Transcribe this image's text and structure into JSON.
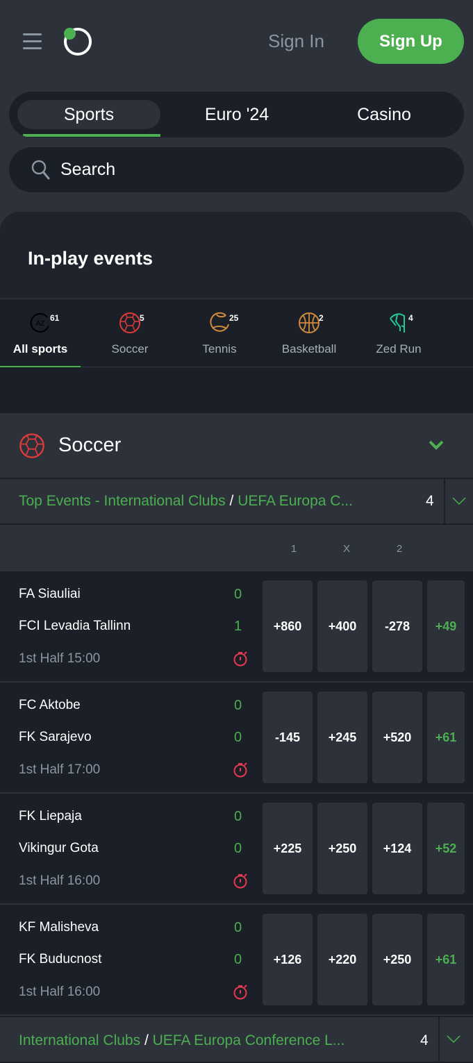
{
  "header": {
    "sign_in": "Sign In",
    "sign_up": "Sign Up"
  },
  "tabs": [
    {
      "label": "Sports",
      "active": true
    },
    {
      "label": "Euro '24"
    },
    {
      "label": "Casino"
    }
  ],
  "search": {
    "placeholder": "Search"
  },
  "inplay": {
    "title": "In-play events"
  },
  "sports": [
    {
      "label": "All sports",
      "count": "61",
      "icon": "az-icon",
      "color": "#000000"
    },
    {
      "label": "Soccer",
      "count": "5",
      "icon": "soccer-ball-icon",
      "color": "#e03a3a"
    },
    {
      "label": "Tennis",
      "count": "25",
      "icon": "tennis-ball-icon",
      "color": "#d08b3c"
    },
    {
      "label": "Basketball",
      "count": "2",
      "icon": "basketball-icon",
      "color": "#d08b3c"
    },
    {
      "label": "Zed Run",
      "count": "4",
      "icon": "horse-icon",
      "color": "#21c99a"
    }
  ],
  "section": {
    "title": "Soccer"
  },
  "competitions": [
    {
      "category": "Top Events - International Clubs",
      "separator": "/",
      "league": "UEFA Europa C...",
      "count": "4"
    },
    {
      "category": "International Clubs",
      "separator": "/",
      "league": "UEFA Europa Conference L...",
      "count": "4"
    }
  ],
  "columns": [
    "1",
    "X",
    "2"
  ],
  "matches": [
    {
      "home": "FA Siauliai",
      "away": "FCI Levadia Tallinn",
      "home_score": "0",
      "away_score": "1",
      "status": "1st Half 15:00",
      "odds": [
        "+860",
        "+400",
        "-278"
      ],
      "more": "+49"
    },
    {
      "home": "FC Aktobe",
      "away": "FK Sarajevo",
      "home_score": "0",
      "away_score": "0",
      "status": "1st Half 17:00",
      "odds": [
        "-145",
        "+245",
        "+520"
      ],
      "more": "+61"
    },
    {
      "home": "FK Liepaja",
      "away": "Vikingur Gota",
      "home_score": "0",
      "away_score": "0",
      "status": "1st Half 16:00",
      "odds": [
        "+225",
        "+250",
        "+124"
      ],
      "more": "+52"
    },
    {
      "home": "KF Malisheva",
      "away": "FK Buducnost",
      "home_score": "0",
      "away_score": "0",
      "status": "1st Half 16:00",
      "odds": [
        "+126",
        "+220",
        "+250"
      ],
      "more": "+61"
    }
  ],
  "colors": {
    "accent": "#4caf50",
    "live": "#e8384f",
    "background": "#2c313a",
    "panel": "#1b1f27"
  }
}
